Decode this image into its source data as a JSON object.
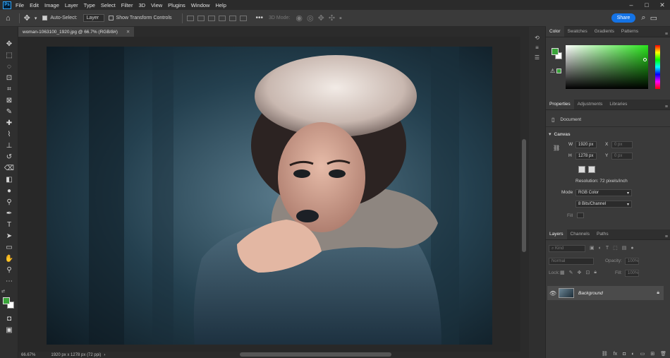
{
  "menubar": {
    "logo": "Ps",
    "items": [
      "File",
      "Edit",
      "Image",
      "Layer",
      "Type",
      "Select",
      "Filter",
      "3D",
      "View",
      "Plugins",
      "Window",
      "Help"
    ],
    "controls": [
      "–",
      "□",
      "✕"
    ]
  },
  "options": {
    "auto_select_label": "Auto-Select:",
    "auto_select_value": "Layer",
    "show_transform_label": "Show Transform Controls",
    "mode_label": "3D Mode:",
    "share_label": "Share"
  },
  "document": {
    "tab_title": "woman-1063100_1920.jpg @ 66.7% (RGB/8#)",
    "zoom": "66.67%",
    "dimensions": "1920 px x 1278 px (72 ppi)"
  },
  "color_panel": {
    "tabs": [
      "Color",
      "Swatches",
      "Gradients",
      "Patterns"
    ],
    "foreground": "#3aa53a",
    "background": "#ffffff"
  },
  "properties_panel": {
    "tabs": [
      "Properties",
      "Adjustments",
      "Libraries"
    ],
    "doc_label": "Document",
    "section": "Canvas",
    "w_label": "W",
    "w_value": "1920 px",
    "h_label": "H",
    "h_value": "1278 px",
    "x_label": "X",
    "x_value": "0 px",
    "y_label": "Y",
    "y_value": "0 px",
    "resolution": "Resolution: 72 pixels/inch",
    "mode_label": "Mode",
    "mode_value": "RGB Color",
    "bits_value": "8 Bits/Channel",
    "fill_label": "Fill"
  },
  "layers_panel": {
    "tabs": [
      "Layers",
      "Channels",
      "Paths"
    ],
    "kind_placeholder": "Kind",
    "blend_mode": "Normal",
    "opacity_label": "Opacity:",
    "opacity_value": "100%",
    "lock_label": "Lock:",
    "fill_label": "Fill:",
    "fill_value": "100%",
    "layer_name": "Background"
  }
}
